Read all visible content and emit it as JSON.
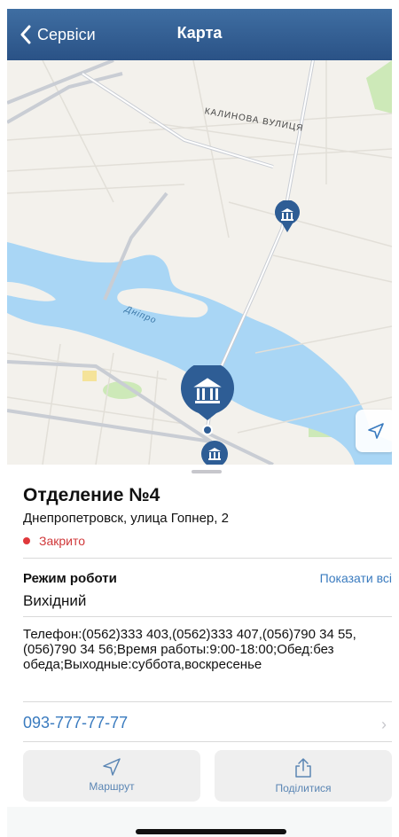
{
  "nav": {
    "back_label": "Сервіси",
    "title": "Карта"
  },
  "map": {
    "street_label": "КАЛИНОВА ВУЛИЦЯ",
    "river_label": "Дніпро"
  },
  "branch": {
    "title": "Отделение №4",
    "address": "Днепропетровск, улица Гопнер, 2",
    "status": "Закрито",
    "hours_title": "Режим роботи",
    "show_all": "Показати всі",
    "hours_value": "Вихідний",
    "info": "Телефон:(0562)333 403,(0562)333 407,(056)790 34 55,(056)790 34 56;Время работы:9:00-18:00;Обед:без обеда;Выходные:суббота,воскресенье",
    "phone": "093-777-77-77"
  },
  "actions": {
    "route_label": "Маршрут",
    "share_label": "Поділитися"
  },
  "colors": {
    "nav": "#2f5a8e",
    "accent": "#3a7bbf",
    "closed": "#e0383b",
    "pin": "#2e5d95",
    "water": "#a9d6f5"
  },
  "icons": [
    "chevron-left-icon",
    "bank-icon",
    "location-arrow-icon",
    "share-icon",
    "chevron-right-icon"
  ]
}
